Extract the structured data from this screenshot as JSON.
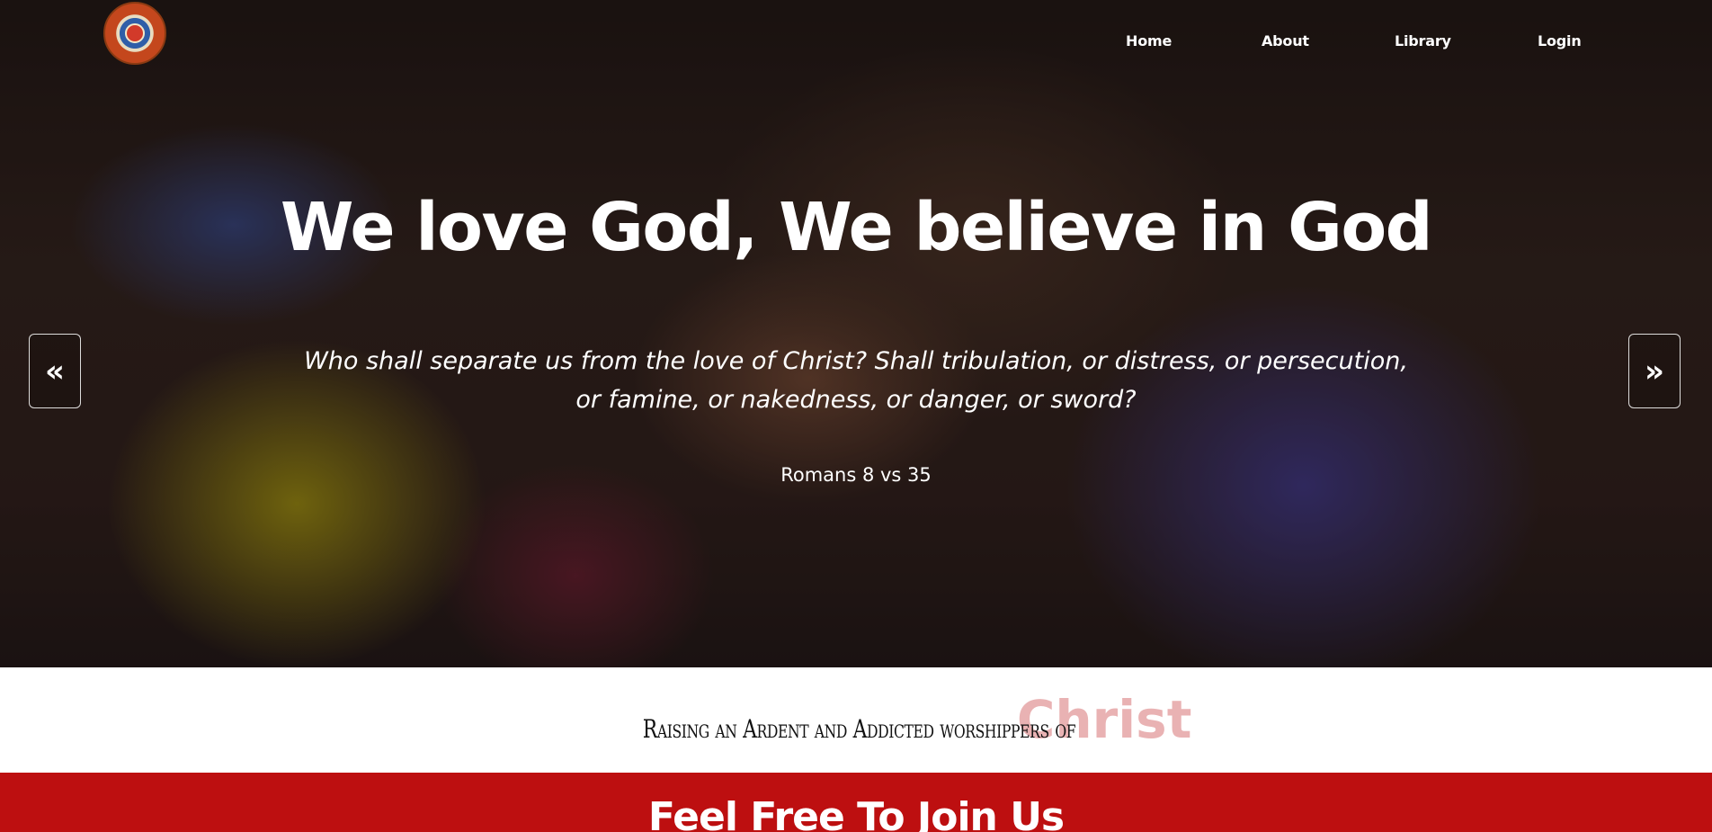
{
  "nav": {
    "logo_alt": "Church logo",
    "items": [
      {
        "label": "Home"
      },
      {
        "label": "About"
      },
      {
        "label": "Library"
      },
      {
        "label": "Login"
      }
    ]
  },
  "hero": {
    "headline": "We love God, We believe in God",
    "verse": "Who shall separate us from the love of Christ? Shall tribulation, or distress, or persecution, or famine, or nakedness, or danger, or sword?",
    "reference": "Romans 8 vs 35",
    "prev_icon": "double-chevron-left-icon",
    "next_icon": "double-chevron-right-icon"
  },
  "tagline": {
    "lead": "Raising an Ardent and Addicted worshippers of",
    "accent": "Christ",
    "accent_color": "#e9b2b3"
  },
  "join": {
    "title": "Feel Free To Join Us",
    "background_color": "#bd0f10"
  }
}
